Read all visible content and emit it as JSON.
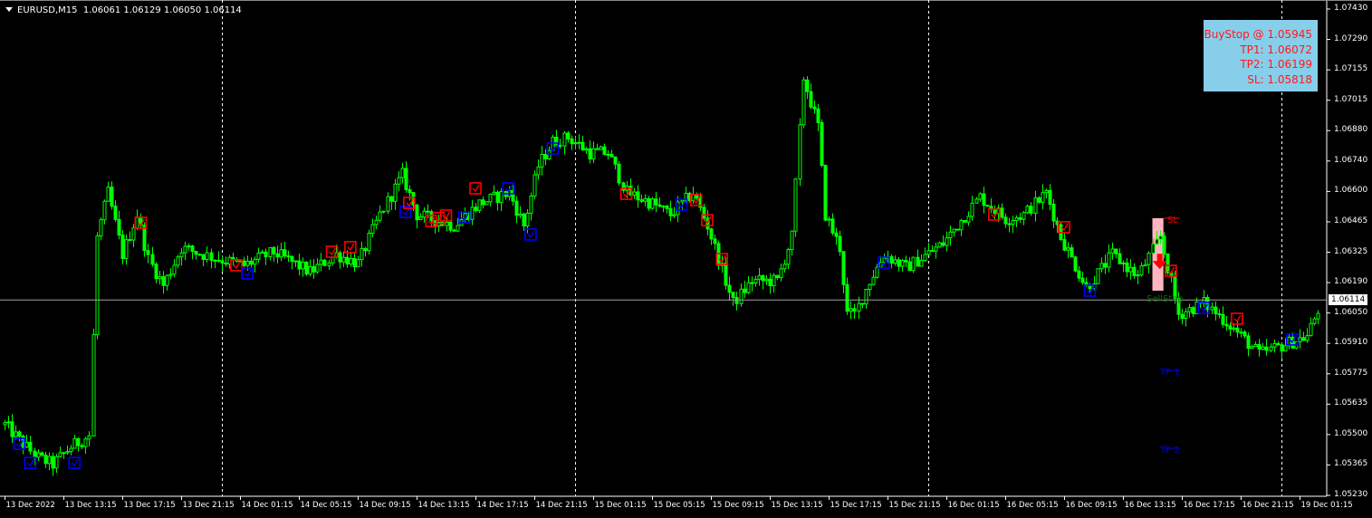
{
  "header": {
    "symbol": "EURUSD,M15",
    "ohlc": "1.06061 1.06129 1.06050 1.06114"
  },
  "info_box": {
    "lines": [
      "BuyStop @ 1.05945",
      "TP1: 1.06072",
      "TP2: 1.06199",
      "SL: 1.05818"
    ],
    "background": "#87ceeb",
    "text_color": "#ff0000"
  },
  "current_price": "1.06114",
  "price_axis": [
    "1.07430",
    "1.07290",
    "1.07155",
    "1.07015",
    "1.06880",
    "1.06740",
    "1.06600",
    "1.06465",
    "1.06325",
    "1.06190",
    "1.06050",
    "1.05910",
    "1.05775",
    "1.05635",
    "1.05500",
    "1.05365",
    "1.05230"
  ],
  "time_axis": [
    "13 Dec 2022",
    "13 Dec 13:15",
    "13 Dec 17:15",
    "13 Dec 21:15",
    "14 Dec 01:15",
    "14 Dec 05:15",
    "14 Dec 09:15",
    "14 Dec 13:15",
    "14 Dec 17:15",
    "14 Dec 21:15",
    "15 Dec 01:15",
    "15 Dec 05:15",
    "15 Dec 09:15",
    "15 Dec 13:15",
    "15 Dec 17:15",
    "15 Dec 21:15",
    "16 Dec 01:15",
    "16 Dec 05:15",
    "16 Dec 09:15",
    "16 Dec 13:15",
    "16 Dec 17:15",
    "16 Dec 21:15",
    "19 Dec 01:15"
  ],
  "signal": {
    "sl_label": "SL",
    "tp1_label": "TP 1",
    "tp2_label": "TP 2",
    "entry_label": "SellStop",
    "sl_price": 1.06484,
    "tp1_price": 1.05795,
    "tp2_price": 1.05443,
    "zone": [
      "16 Dec 15:15",
      "16 Dec 16:00",
      1.06484,
      1.06156
    ],
    "arrow": [
      "16 Dec 15:45",
      1.0629
    ]
  },
  "chart_data": {
    "type": "candlestick",
    "symbol": "EURUSD",
    "timeframe": "M15",
    "ylim": [
      1.0523,
      1.0743
    ],
    "candle_color": "#00ff00",
    "day_separators": [
      "14 Dec 00:00",
      "15 Dec 00:00",
      "16 Dec 00:00",
      "19 Dec 00:00"
    ],
    "price_path": [
      [
        "13 Dec 09:15",
        1.0555
      ],
      [
        "13 Dec 10:15",
        1.0548
      ],
      [
        "13 Dec 11:30",
        1.054
      ],
      [
        "13 Dec 12:30",
        1.0537
      ],
      [
        "13 Dec 13:45",
        1.0545
      ],
      [
        "13 Dec 15:00",
        1.055
      ],
      [
        "13 Dec 15:30",
        1.064
      ],
      [
        "13 Dec 16:15",
        1.066
      ],
      [
        "13 Dec 17:15",
        1.0632
      ],
      [
        "13 Dec 18:15",
        1.065
      ],
      [
        "13 Dec 19:00",
        1.063
      ],
      [
        "13 Dec 20:00",
        1.0618
      ],
      [
        "13 Dec 21:15",
        1.0635
      ],
      [
        "13 Dec 23:45",
        1.063
      ],
      [
        "14 Dec 01:30",
        1.0627
      ],
      [
        "14 Dec 03:30",
        1.0633
      ],
      [
        "14 Dec 06:00",
        1.0624
      ],
      [
        "14 Dec 07:45",
        1.0632
      ],
      [
        "14 Dec 09:15",
        1.0628
      ],
      [
        "14 Dec 10:45",
        1.065
      ],
      [
        "14 Dec 12:15",
        1.0668
      ],
      [
        "14 Dec 13:15",
        1.065
      ],
      [
        "14 Dec 15:45",
        1.0645
      ],
      [
        "14 Dec 17:30",
        1.0655
      ],
      [
        "14 Dec 19:30",
        1.066
      ],
      [
        "14 Dec 20:30",
        1.0645
      ],
      [
        "14 Dec 21:30",
        1.0672
      ],
      [
        "14 Dec 22:30",
        1.0683
      ],
      [
        "14 Dec 23:30",
        1.0685
      ],
      [
        "15 Dec 01:00",
        1.0678
      ],
      [
        "15 Dec 02:15",
        1.0678
      ],
      [
        "15 Dec 03:30",
        1.066
      ],
      [
        "15 Dec 05:15",
        1.0655
      ],
      [
        "15 Dec 06:30",
        1.065
      ],
      [
        "15 Dec 08:00",
        1.066
      ],
      [
        "15 Dec 09:00",
        1.0645
      ],
      [
        "15 Dec 10:15",
        1.062
      ],
      [
        "15 Dec 10:45",
        1.061
      ],
      [
        "15 Dec 12:00",
        1.062
      ],
      [
        "15 Dec 13:45",
        1.062
      ],
      [
        "15 Dec 14:45",
        1.064
      ],
      [
        "15 Dec 15:30",
        1.0712
      ],
      [
        "15 Dec 16:30",
        1.069
      ],
      [
        "15 Dec 17:00",
        1.065
      ],
      [
        "15 Dec 18:00",
        1.0635
      ],
      [
        "15 Dec 18:30",
        1.0605
      ],
      [
        "15 Dec 19:00",
        1.0605
      ],
      [
        "15 Dec 20:00",
        1.062
      ],
      [
        "15 Dec 21:00",
        1.0632
      ],
      [
        "15 Dec 22:30",
        1.0626
      ],
      [
        "16 Dec 01:00",
        1.0637
      ],
      [
        "16 Dec 03:30",
        1.0658
      ],
      [
        "16 Dec 05:15",
        1.0648
      ],
      [
        "16 Dec 06:30",
        1.065
      ],
      [
        "16 Dec 08:00",
        1.066
      ],
      [
        "16 Dec 09:00",
        1.064
      ],
      [
        "16 Dec 10:45",
        1.0617
      ],
      [
        "16 Dec 12:30",
        1.0632
      ],
      [
        "16 Dec 14:15",
        1.0622
      ],
      [
        "16 Dec 15:45",
        1.064
      ],
      [
        "16 Dec 17:00",
        1.0605
      ],
      [
        "16 Dec 18:45",
        1.061
      ],
      [
        "16 Dec 20:30",
        1.06
      ],
      [
        "16 Dec 22:30",
        1.0587
      ],
      [
        "19 Dec 00:30",
        1.0592
      ],
      [
        "19 Dec 01:45",
        1.0595
      ],
      [
        "19 Dec 02:45",
        1.0611
      ]
    ],
    "markers": [
      {
        "color": "#0000ff",
        "time": "13 Dec 10:15",
        "price": 1.05463
      },
      {
        "color": "#0000ff",
        "time": "13 Dec 11:00",
        "price": 1.05377
      },
      {
        "color": "#0000ff",
        "time": "13 Dec 14:00",
        "price": 1.05377
      },
      {
        "color": "#ff0000",
        "time": "13 Dec 18:30",
        "price": 1.06463
      },
      {
        "color": "#ff0000",
        "time": "14 Dec 01:00",
        "price": 1.06271
      },
      {
        "color": "#0000ff",
        "time": "14 Dec 01:45",
        "price": 1.06234
      },
      {
        "color": "#ff0000",
        "time": "14 Dec 07:30",
        "price": 1.06332
      },
      {
        "color": "#ff0000",
        "time": "14 Dec 08:45",
        "price": 1.06353
      },
      {
        "color": "#0000ff",
        "time": "14 Dec 12:30",
        "price": 1.06512
      },
      {
        "color": "#ff0000",
        "time": "14 Dec 12:45",
        "price": 1.06553
      },
      {
        "color": "#ff0000",
        "time": "14 Dec 14:15",
        "price": 1.06471
      },
      {
        "color": "#ff0000",
        "time": "14 Dec 14:45",
        "price": 1.06484
      },
      {
        "color": "#ff0000",
        "time": "14 Dec 15:15",
        "price": 1.06496
      },
      {
        "color": "#0000ff",
        "time": "14 Dec 16:30",
        "price": 1.06488
      },
      {
        "color": "#ff0000",
        "time": "14 Dec 17:15",
        "price": 1.06619
      },
      {
        "color": "#0000ff",
        "time": "14 Dec 19:30",
        "price": 1.06619
      },
      {
        "color": "#0000ff",
        "time": "14 Dec 21:00",
        "price": 1.0641
      },
      {
        "color": "#0000ff",
        "time": "14 Dec 22:30",
        "price": 1.06799
      },
      {
        "color": "#ff0000",
        "time": "15 Dec 03:30",
        "price": 1.06594
      },
      {
        "color": "#0000ff",
        "time": "15 Dec 07:15",
        "price": 1.06545
      },
      {
        "color": "#ff0000",
        "time": "15 Dec 08:15",
        "price": 1.06566
      },
      {
        "color": "#ff0000",
        "time": "15 Dec 09:00",
        "price": 1.06475
      },
      {
        "color": "#ff0000",
        "time": "15 Dec 10:00",
        "price": 1.06299
      },
      {
        "color": "#0000ff",
        "time": "15 Dec 21:00",
        "price": 1.06283
      },
      {
        "color": "#ff0000",
        "time": "16 Dec 04:30",
        "price": 1.065
      },
      {
        "color": "#ff0000",
        "time": "16 Dec 09:15",
        "price": 1.06443
      },
      {
        "color": "#0000ff",
        "time": "16 Dec 11:00",
        "price": 1.06156
      },
      {
        "color": "#ff0000",
        "time": "16 Dec 16:30",
        "price": 1.06246
      },
      {
        "color": "#0000ff",
        "time": "16 Dec 18:45",
        "price": 1.06078
      },
      {
        "color": "#ff0000",
        "time": "16 Dec 21:00",
        "price": 1.06029
      },
      {
        "color": "#0000ff",
        "time": "19 Dec 00:45",
        "price": 1.05935
      }
    ]
  }
}
